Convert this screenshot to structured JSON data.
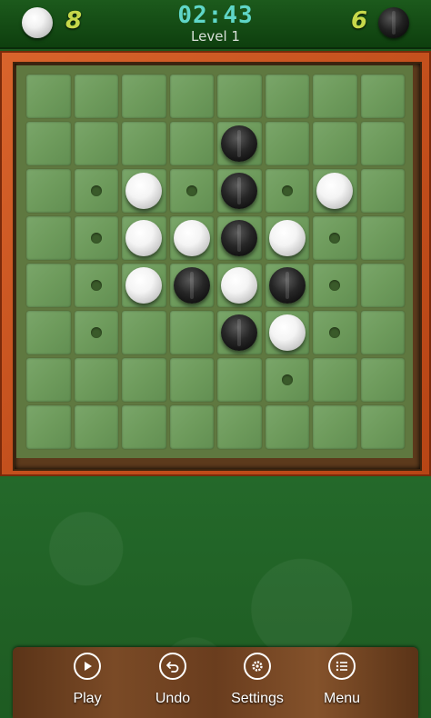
{
  "header": {
    "white_score": "8",
    "black_score": "6",
    "timer": "02:43",
    "level": "Level 1"
  },
  "board": {
    "size": 8,
    "rows": [
      [
        "",
        "",
        "",
        "",
        "",
        "",
        "",
        ""
      ],
      [
        "",
        "",
        "",
        "",
        "B",
        "",
        "",
        ""
      ],
      [
        "",
        "h",
        "W",
        "h",
        "B",
        "h",
        "W",
        ""
      ],
      [
        "",
        "h",
        "W",
        "W",
        "B",
        "W",
        "h",
        ""
      ],
      [
        "",
        "h",
        "W",
        "B",
        "W",
        "B",
        "h",
        ""
      ],
      [
        "",
        "h",
        "",
        "",
        "B",
        "W",
        "h",
        ""
      ],
      [
        "",
        "",
        "",
        "",
        "",
        "h",
        "",
        ""
      ],
      [
        "",
        "",
        "",
        "",
        "",
        "",
        "",
        ""
      ]
    ],
    "legend": {
      "W": "white-disc",
      "B": "black-disc",
      "h": "valid-move-hint"
    }
  },
  "toolbar": {
    "play_label": "Play",
    "undo_label": "Undo",
    "settings_label": "Settings",
    "menu_label": "Menu"
  },
  "colors": {
    "frame": "#c9541f",
    "cell": "#6f9c5e",
    "timer": "#5fd6c8",
    "score": "#c6d84a"
  }
}
